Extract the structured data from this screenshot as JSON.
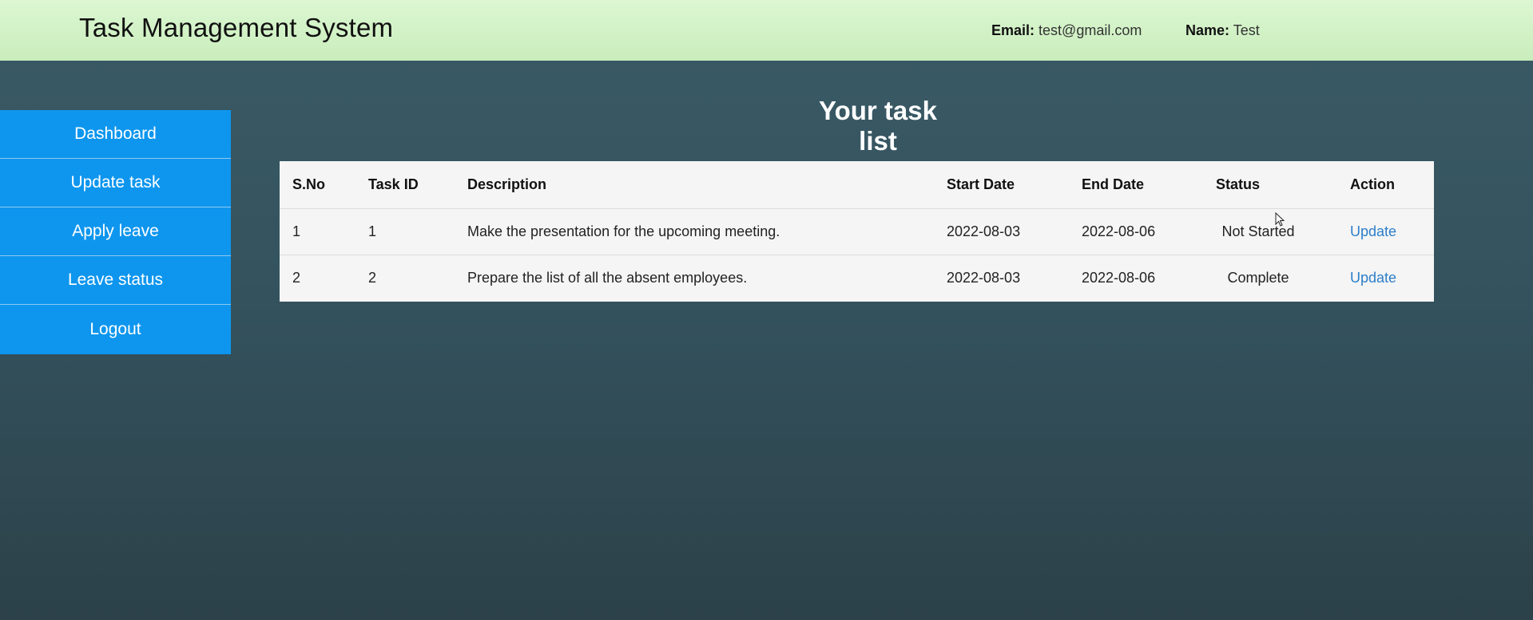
{
  "header": {
    "title": "Task Management System",
    "email_label": "Email:",
    "email_value": "test@gmail.com",
    "name_label": "Name:",
    "name_value": "Test"
  },
  "sidebar": {
    "items": [
      {
        "label": "Dashboard"
      },
      {
        "label": "Update task"
      },
      {
        "label": "Apply leave"
      },
      {
        "label": "Leave status"
      },
      {
        "label": "Logout"
      }
    ]
  },
  "main": {
    "title": "Your task list",
    "table": {
      "headers": [
        "S.No",
        "Task ID",
        "Description",
        "Start Date",
        "End Date",
        "Status",
        "Action"
      ],
      "rows": [
        {
          "sno": "1",
          "task_id": "1",
          "description": "Make the presentation for the upcoming meeting.",
          "start": "2022-08-03",
          "end": "2022-08-06",
          "status": "Not Started",
          "action": "Update"
        },
        {
          "sno": "2",
          "task_id": "2",
          "description": "Prepare the list of all the absent employees.",
          "start": "2022-08-03",
          "end": "2022-08-06",
          "status": "Complete",
          "action": "Update"
        }
      ]
    }
  },
  "colors": {
    "header_bg": "#d4f4c8",
    "sidebar_bg": "#0e96ee",
    "page_bg": "#34535f",
    "link": "#2d7ec8"
  }
}
